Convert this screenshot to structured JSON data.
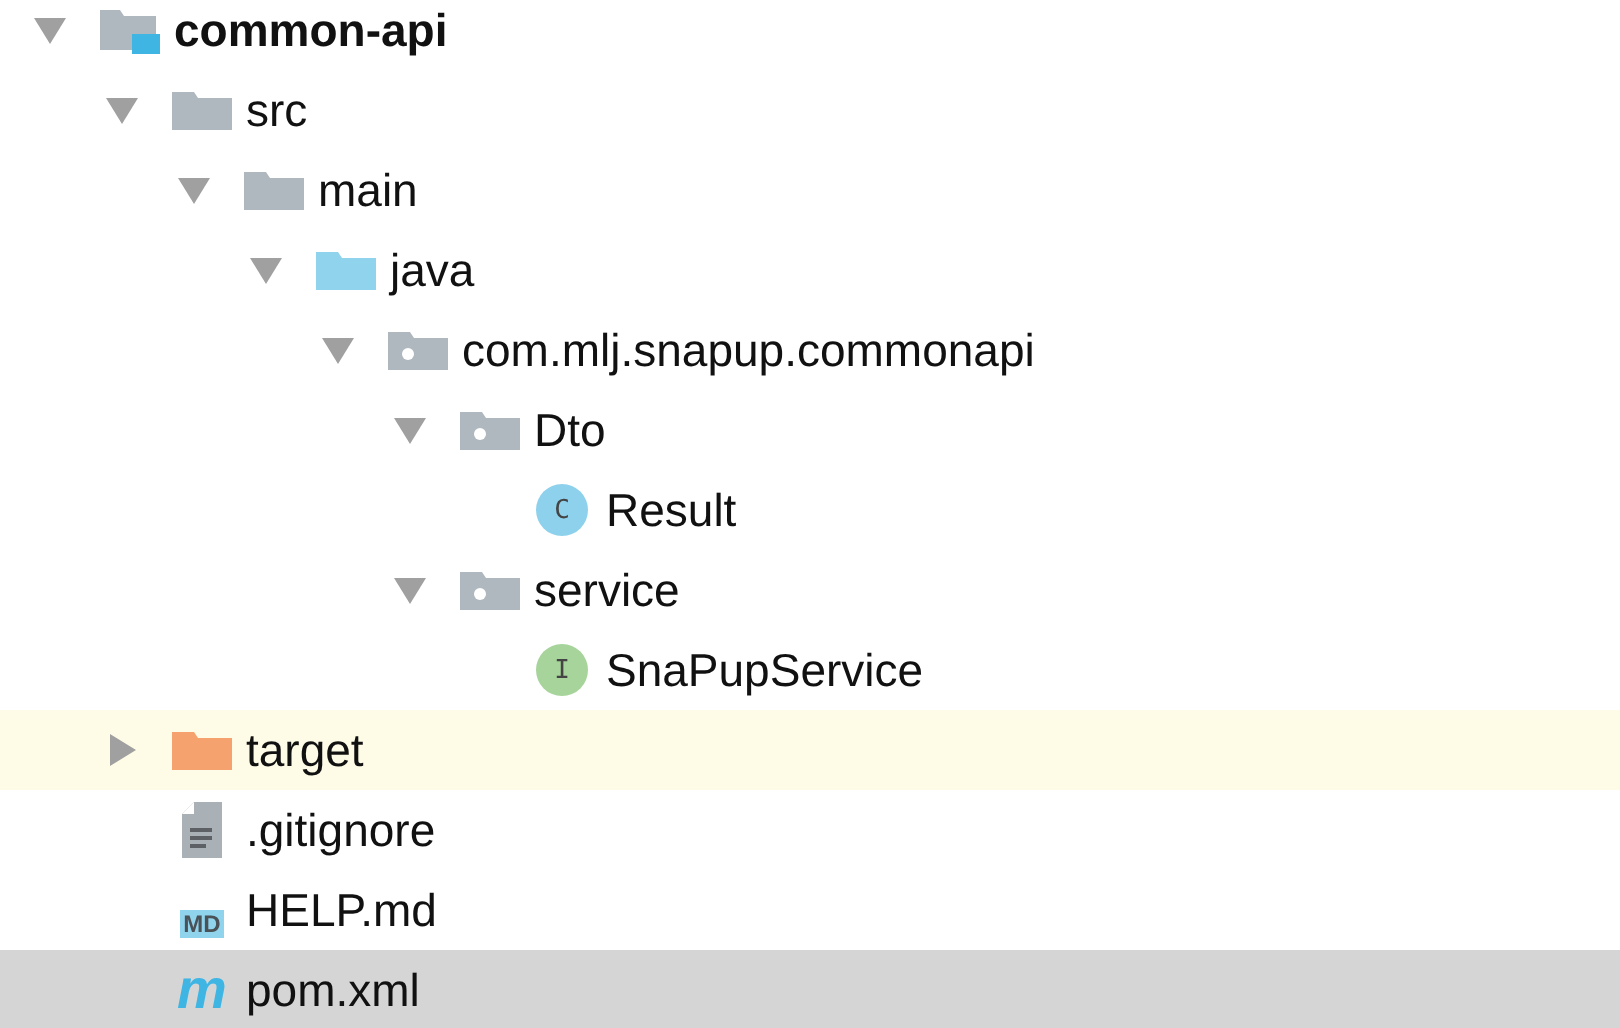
{
  "tree": [
    {
      "label": "common-api",
      "kind": "module",
      "expanded": true,
      "selected": false,
      "highlighted": false,
      "children": [
        {
          "label": "src",
          "kind": "folder",
          "expanded": true,
          "selected": false,
          "highlighted": false,
          "children": [
            {
              "label": "main",
              "kind": "folder",
              "expanded": true,
              "selected": false,
              "highlighted": false,
              "children": [
                {
                  "label": "java",
                  "kind": "source-folder",
                  "expanded": true,
                  "selected": false,
                  "highlighted": false,
                  "children": [
                    {
                      "label": "com.mlj.snapup.commonapi",
                      "kind": "package",
                      "expanded": true,
                      "selected": false,
                      "highlighted": false,
                      "children": [
                        {
                          "label": "Dto",
                          "kind": "package",
                          "expanded": true,
                          "selected": false,
                          "highlighted": false,
                          "children": [
                            {
                              "label": "Result",
                              "kind": "class",
                              "icon_text": "C",
                              "selected": false,
                              "highlighted": false
                            }
                          ]
                        },
                        {
                          "label": "service",
                          "kind": "package",
                          "expanded": true,
                          "selected": false,
                          "highlighted": false,
                          "children": [
                            {
                              "label": "SnaPupService",
                              "kind": "interface",
                              "icon_text": "I",
                              "selected": false,
                              "highlighted": false
                            }
                          ]
                        }
                      ]
                    }
                  ]
                }
              ]
            }
          ]
        },
        {
          "label": "target",
          "kind": "excluded-folder",
          "expanded": false,
          "selected": false,
          "highlighted": true
        },
        {
          "label": ".gitignore",
          "kind": "text-file",
          "selected": false,
          "highlighted": false
        },
        {
          "label": "HELP.md",
          "kind": "markdown",
          "icon_text": "MD",
          "selected": false,
          "highlighted": false
        },
        {
          "label": "pom.xml",
          "kind": "maven",
          "icon_text": "m",
          "selected": true,
          "highlighted": false
        }
      ]
    }
  ]
}
